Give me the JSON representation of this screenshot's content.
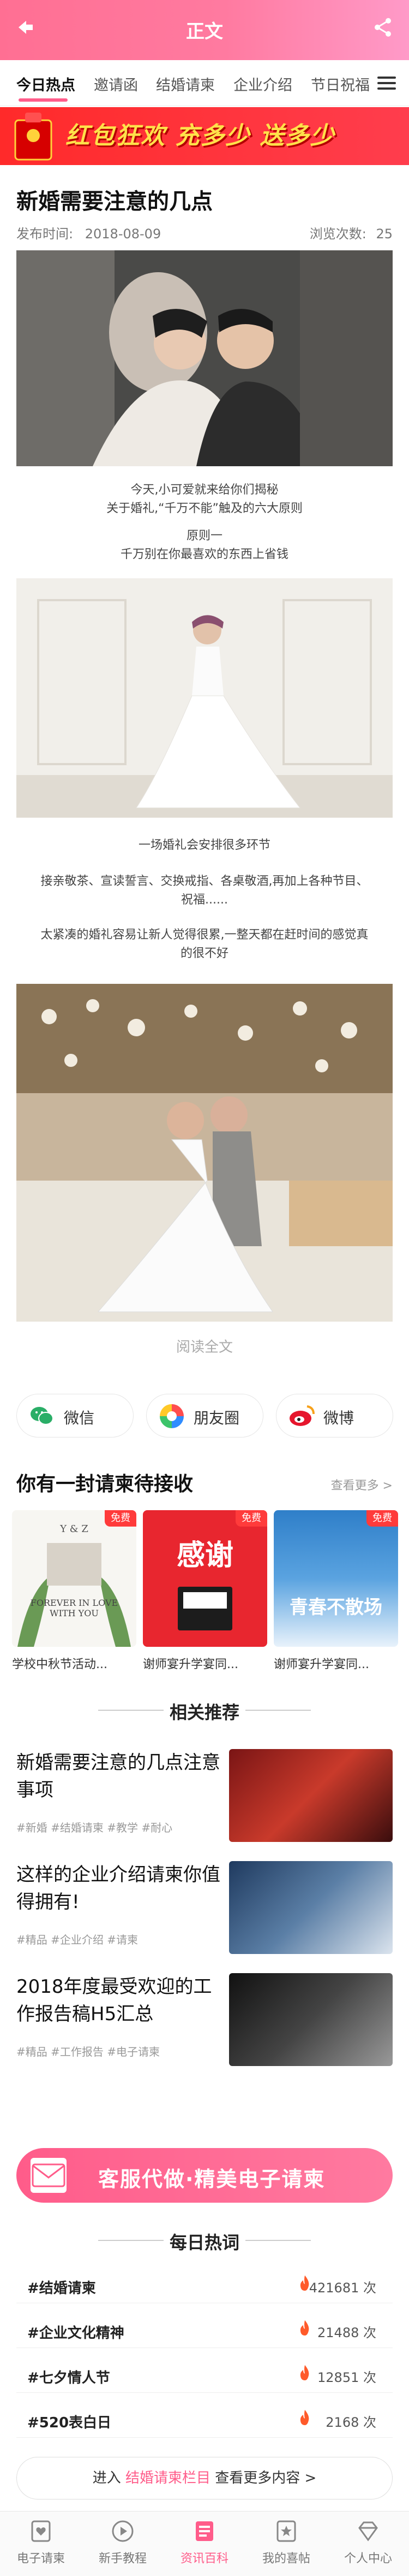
{
  "topbar": {
    "title": "正文"
  },
  "tabs": [
    "今日热点",
    "邀请函",
    "结婚请柬",
    "企业介绍",
    "节日祝福"
  ],
  "banner": {
    "text": "红包狂欢 充多少 送多少"
  },
  "article": {
    "title": "新婚需要注意的几点",
    "publish_label": "发布时间:",
    "publish_date": "2018-08-09",
    "views_label": "浏览次数:",
    "views": "25",
    "p1_line1": "今天,小可爱就来给你们揭秘",
    "p1_line2": "关于婚礼,“千万不能”触及的六大原则",
    "p2_line1": "原则一",
    "p2_line2": "千万别在你最喜欢的东西上省钱",
    "p3": "一场婚礼会安排很多环节",
    "p4_line1": "接亲敬茶、宣读誓言、交换戒指、各桌敬酒,再加上各种节目、",
    "p4_line2": "祝福......",
    "p5_line1": "太紧凑的婚礼容易让新人觉得很累,一整天都在赶时间的感觉真",
    "p5_line2": "的很不好"
  },
  "read_more": "阅读全文",
  "share": {
    "wechat": "微信",
    "moments": "朋友圈",
    "weibo": "微博"
  },
  "invites": {
    "title": "你有一封请柬待接收",
    "more": "查看更多 >",
    "free_badge": "免费",
    "cards": [
      {
        "caption": "学校中秋节活动...",
        "thumb_text": "FOREVER IN LOVE WITH YOU"
      },
      {
        "caption": "谢师宴升学宴同...",
        "thumb_text": "感谢"
      },
      {
        "caption": "谢师宴升学宴同...",
        "thumb_text": "青春不散场"
      }
    ]
  },
  "related": {
    "title": "相关推荐",
    "items": [
      {
        "title": "新婚需要注意的几点注意事项",
        "tags": "#新婚  #结婚请柬  #教学  #耐心"
      },
      {
        "title": "这样的企业介绍请柬你值得拥有!",
        "tags": "#精品  #企业介绍  #请柬"
      },
      {
        "title": "2018年度最受欢迎的工作报告稿H5汇总",
        "tags": "#精品  #工作报告  #电子请柬"
      }
    ]
  },
  "cta": {
    "text": "客服代做·精美电子请柬"
  },
  "hotwords": {
    "title": "每日热词",
    "items": [
      {
        "word": "#结婚请柬",
        "count": "421681 次"
      },
      {
        "word": "#企业文化精神",
        "count": "21488 次"
      },
      {
        "word": "#七夕情人节",
        "count": "12851 次"
      },
      {
        "word": "#520表白日",
        "count": "2168 次"
      }
    ]
  },
  "enter": {
    "prefix": "进入 ",
    "highlight": "结婚请柬栏目",
    "suffix": " 查看更多内容 >"
  },
  "bottom_nav": [
    "电子请柬",
    "新手教程",
    "资讯百科",
    "我的喜帖",
    "个人中心"
  ],
  "colors": {
    "accent": "#ff5c8a",
    "banner_red": "#ff2a2a",
    "banner_yellow": "#ffe14a"
  }
}
